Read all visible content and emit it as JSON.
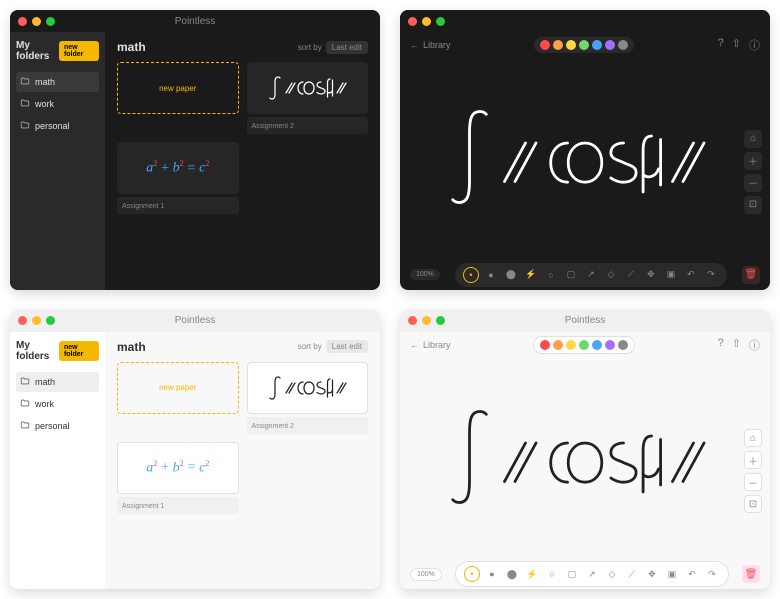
{
  "app_title": "Pointless",
  "sidebar": {
    "title": "My folders",
    "new_folder_label": "new folder",
    "folders": [
      "math",
      "work",
      "personal"
    ]
  },
  "library": {
    "folder_title": "math",
    "sort_label": "sort by",
    "sort_value": "Last edit",
    "new_paper_label": "new paper",
    "papers": [
      {
        "name": "Assignment 2",
        "content_desc": "∫ x cos(x) dx"
      },
      {
        "name": "Assignment 1",
        "content_desc": "a² + b² = c²"
      }
    ]
  },
  "canvas": {
    "back_label": "Library",
    "palette_colors": [
      "#ff4a4a",
      "#ff9f4a",
      "#ffd84a",
      "#6fd86f",
      "#4aa3ff",
      "#a46fff",
      "#888888"
    ],
    "formula_desc": "∫ x cos(x) dx",
    "zoom": "100%",
    "toolbar_names": [
      "pen-small",
      "pen-medium",
      "pen-large",
      "lightning",
      "circle",
      "square",
      "arrow",
      "eraser",
      "ruler",
      "move",
      "select",
      "undo",
      "redo"
    ],
    "side_tool_names": [
      "home",
      "zoom-in",
      "zoom-out",
      "fit"
    ],
    "head_icon_names": [
      "help",
      "share",
      "info"
    ]
  }
}
